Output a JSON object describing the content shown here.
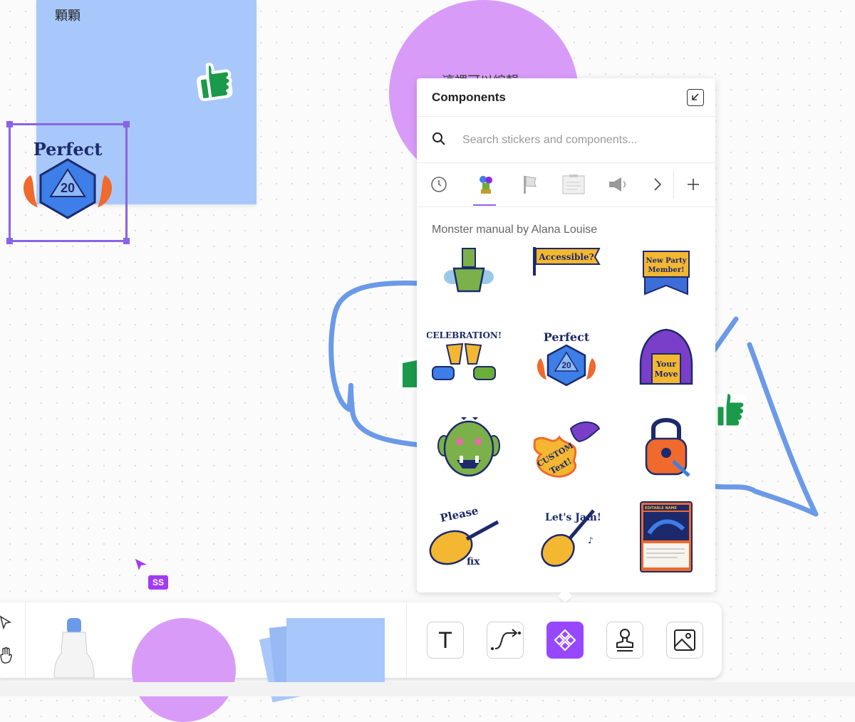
{
  "canvas": {
    "sticky_note_text": "顆顆",
    "circle_text": "這裡可以編輯",
    "collaborator_cursor_label": "SS"
  },
  "components_panel": {
    "title": "Components",
    "search_placeholder": "Search stickers and components...",
    "tabs": [
      "recent-icon",
      "monster-manual-pack-icon",
      "flag-pack-icon",
      "clipboard-pack-icon",
      "megaphone-pack-icon",
      "next-icon",
      "add-icon"
    ],
    "active_tab": "monster-manual-pack-icon",
    "section_label": "Monster manual by Alana Louise",
    "stickers": [
      {
        "name": "potion-sticker",
        "text": ""
      },
      {
        "name": "accessible-banner-sticker",
        "text": "Accessible?"
      },
      {
        "name": "new-party-member-sticker",
        "text": "New Party Member!"
      },
      {
        "name": "celebration-sticker",
        "text": "CELEBRATION!"
      },
      {
        "name": "perfect-d20-sticker",
        "text": "Perfect"
      },
      {
        "name": "your-move-sticker",
        "text": "Your Move"
      },
      {
        "name": "orc-face-sticker",
        "text": ""
      },
      {
        "name": "dragon-custom-text-sticker",
        "text": "CUSTOM Text!"
      },
      {
        "name": "padlock-sticker",
        "text": ""
      },
      {
        "name": "please-fix-lute-sticker",
        "text": "Please fix"
      },
      {
        "name": "lets-jam-lute-sticker",
        "text": "Let's Jam!"
      },
      {
        "name": "editable-card-sticker",
        "text": "EDITABLE NAME"
      }
    ]
  },
  "selected_sticker_text": "Perfect",
  "d20_value": "20",
  "toolbar": {
    "tools": [
      "text-tool",
      "connector-tool",
      "components-tool",
      "stamp-tool",
      "image-tool"
    ],
    "active_tool": "components-tool",
    "text_tool_glyph": "T"
  },
  "colors": {
    "accent": "#9747ff",
    "selection": "#8a63e6",
    "sticky_blue": "#a8c8fb",
    "circle_purple": "#d89cf8",
    "pen_blue": "#6a9ae8",
    "thumb_green": "#1a9a4a"
  }
}
